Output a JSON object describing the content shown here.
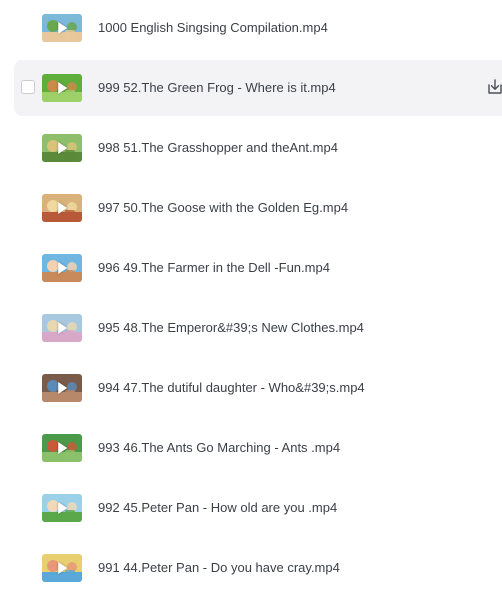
{
  "files": [
    {
      "name": "1000 English Singsing Compilation.mp4",
      "palette": [
        "#7cb8d8",
        "#e8c89a",
        "#6aa84f"
      ]
    },
    {
      "name": "999 52.The Green Frog - Where is it.mp4",
      "palette": [
        "#5fae3c",
        "#9ed06a",
        "#c98a4a"
      ]
    },
    {
      "name": "998 51.The Grasshopper and theAnt.mp4",
      "palette": [
        "#8fbf6a",
        "#5a8a3a",
        "#d9c27a"
      ]
    },
    {
      "name": "997 50.The Goose with the Golden Eg.mp4",
      "palette": [
        "#d8b27a",
        "#b85a3a",
        "#f0d8a0"
      ]
    },
    {
      "name": "996 49.The Farmer in the Dell -Fun.mp4",
      "palette": [
        "#6fb6e0",
        "#c88a5a",
        "#f2d2b0"
      ]
    },
    {
      "name": "995 48.The Emperor&#39;s New Clothes.mp4",
      "palette": [
        "#a8c8e0",
        "#d8a8c8",
        "#e8d8b0"
      ]
    },
    {
      "name": "994 47.The dutiful daughter - Who&#39;s.mp4",
      "palette": [
        "#7a5a48",
        "#b8886a",
        "#5a8ab8"
      ]
    },
    {
      "name": "993 46.The Ants Go Marching - Ants .mp4",
      "palette": [
        "#4a9a4a",
        "#8ac06a",
        "#c85a3a"
      ]
    },
    {
      "name": "992 45.Peter Pan - How old are you .mp4",
      "palette": [
        "#9ad0e8",
        "#5aa84a",
        "#f0d8b8"
      ]
    },
    {
      "name": "991 44.Peter Pan - Do you have cray.mp4",
      "palette": [
        "#e8d070",
        "#5aa8d8",
        "#e89878"
      ]
    }
  ],
  "hovered_index": 1,
  "icons": {
    "play": "play-icon",
    "download": "download-icon",
    "checkbox": "checkbox"
  }
}
